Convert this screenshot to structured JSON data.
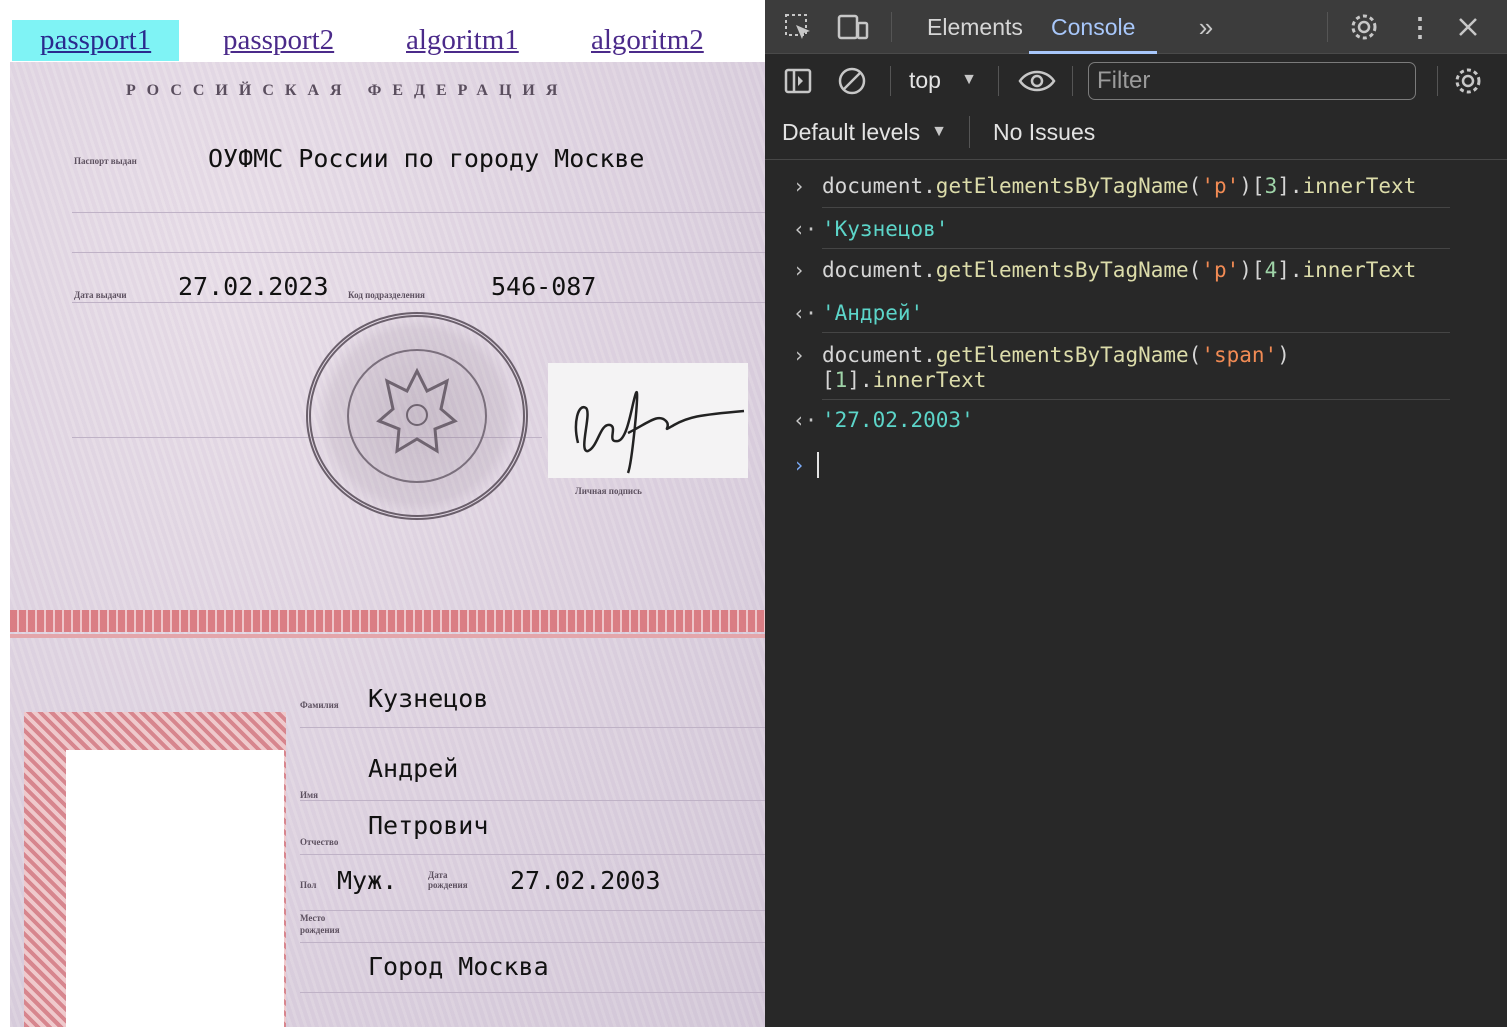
{
  "nav": {
    "links": [
      "passport1",
      "passport2",
      "algoritm1",
      "algoritm2"
    ],
    "active": "passport1"
  },
  "passport": {
    "header": "РОССИЙСКАЯ ФЕДЕРАЦИЯ",
    "label_issued_by": "Паспорт выдан",
    "issued_by": "ОУФМС России по городу Москве",
    "label_issue_date": "Дата выдачи",
    "issue_date": "27.02.2023",
    "label_dept_code": "Код подразделения",
    "dept_code": "546-087",
    "label_signature": "Личная подпись",
    "label_surname": "Фамилия",
    "surname": "Кузнецов",
    "label_name": "Имя",
    "name": "Андрей",
    "label_patronymic": "Отчество",
    "patronymic": "Петрович",
    "label_sex": "Пол",
    "sex": "Муж.",
    "label_birth_date": "Дата рождения",
    "birth_date": "27.02.2003",
    "label_birth_place": "Место рождения",
    "birth_place": "Город Москва"
  },
  "devtools": {
    "tabs": [
      "Elements",
      "Console"
    ],
    "active_tab": "Console",
    "context": "top",
    "filter_placeholder": "Filter",
    "levels": "Default levels",
    "issues": "No Issues",
    "colors": {
      "background": "#282828",
      "toolbar": "#3c3c3c",
      "active_tab": "#a8c7fa",
      "string": "#f28b54",
      "function": "#dcdcaa",
      "result": "#5cd5c9"
    },
    "console": [
      {
        "type": "input",
        "parts": [
          [
            "c-doc",
            "document."
          ],
          [
            "c-fn",
            "getElementsByTagName"
          ],
          [
            "c-doc",
            "("
          ],
          [
            "c-str",
            "'p'"
          ],
          [
            "c-doc",
            ")["
          ],
          [
            "c-num",
            "3"
          ],
          [
            "c-doc",
            "]."
          ],
          [
            "c-fn",
            "innerText"
          ]
        ]
      },
      {
        "type": "output",
        "text": "'Кузнецов'"
      },
      {
        "type": "input",
        "parts": [
          [
            "c-doc",
            "document."
          ],
          [
            "c-fn",
            "getElementsByTagName"
          ],
          [
            "c-doc",
            "("
          ],
          [
            "c-str",
            "'p'"
          ],
          [
            "c-doc",
            ")["
          ],
          [
            "c-num",
            "4"
          ],
          [
            "c-doc",
            "]."
          ],
          [
            "c-fn",
            "innerText"
          ]
        ]
      },
      {
        "type": "output",
        "text": "'Андрей'"
      },
      {
        "type": "input",
        "parts": [
          [
            "c-doc",
            "document."
          ],
          [
            "c-fn",
            "getElementsByTagName"
          ],
          [
            "c-doc",
            "("
          ],
          [
            "c-str",
            "'span'"
          ],
          [
            "c-doc",
            ")\n["
          ],
          [
            "c-num",
            "1"
          ],
          [
            "c-doc",
            "]."
          ],
          [
            "c-fn",
            "innerText"
          ]
        ]
      },
      {
        "type": "output",
        "text": "'27.02.2003'"
      }
    ]
  }
}
